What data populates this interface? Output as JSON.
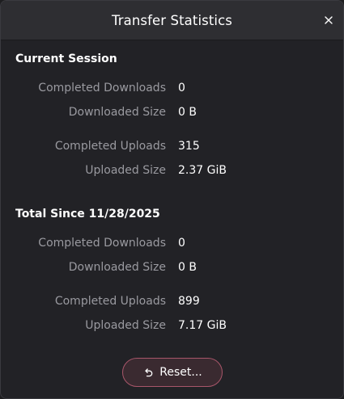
{
  "window": {
    "title": "Transfer Statistics",
    "close_icon": "close-icon"
  },
  "current_session": {
    "heading": "Current Session",
    "completed_downloads_label": "Completed Downloads",
    "completed_downloads_value": "0",
    "downloaded_size_label": "Downloaded Size",
    "downloaded_size_value": "0 B",
    "completed_uploads_label": "Completed Uploads",
    "completed_uploads_value": "315",
    "uploaded_size_label": "Uploaded Size",
    "uploaded_size_value": "2.37 GiB"
  },
  "total": {
    "heading": "Total Since 11/28/2025",
    "completed_downloads_label": "Completed Downloads",
    "completed_downloads_value": "0",
    "downloaded_size_label": "Downloaded Size",
    "downloaded_size_value": "0 B",
    "completed_uploads_label": "Completed Uploads",
    "completed_uploads_value": "899",
    "uploaded_size_label": "Uploaded Size",
    "uploaded_size_value": "7.17 GiB"
  },
  "reset_button": {
    "label": "Reset...",
    "icon": "undo-icon"
  },
  "colors": {
    "background": "#222226",
    "titlebar": "#2e2e32",
    "label": "#9a9aa0",
    "value": "#ffffff",
    "destructive_border": "#a8566a"
  }
}
